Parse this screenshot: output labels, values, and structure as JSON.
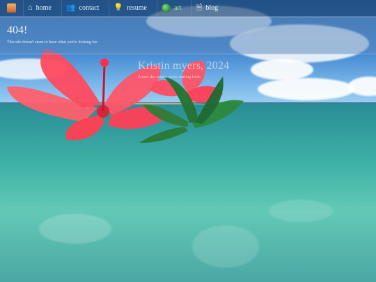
{
  "nav": {
    "logo_icon": "avatar-icon",
    "items": [
      {
        "label": "home",
        "icon": "home-icon"
      },
      {
        "label": "contact",
        "icon": "contacts-icon"
      },
      {
        "label": "resume",
        "icon": "lightbulb-icon"
      },
      {
        "label": "art",
        "icon": "lab-icon",
        "accent": "#8ee08f"
      },
      {
        "label": "blog",
        "icon": "document-icon"
      }
    ]
  },
  "hero": {
    "title": "404!",
    "subtitle": "This site doesn't seem to have what you're looking for."
  },
  "background_overlay": {
    "name": "Kristin myers, 2024",
    "tagline": "A new day means we're starting fresh"
  },
  "colors": {
    "navbar": "#234b78",
    "hero_panel": "#5f8cbf",
    "sea": "#3fb3a7",
    "sky": "#3f85cf"
  }
}
